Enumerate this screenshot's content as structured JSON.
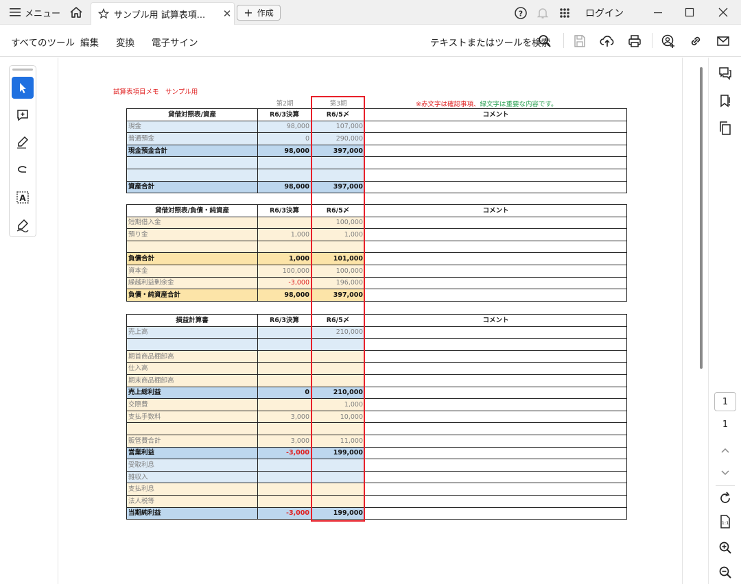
{
  "titlebar": {
    "menu_label": "メニュー",
    "tab_title": "サンプル用  試算表項...",
    "create_label": "作成",
    "login_label": "ログイン"
  },
  "toolbar": {
    "all_tools": "すべてのツール",
    "edit": "編集",
    "convert": "変換",
    "esign": "電子サイン",
    "search_text": "テキストまたはツールを検索"
  },
  "page_nav": {
    "current": "1",
    "total": "1"
  },
  "sheet": {
    "title": "試算表項目メモ　サンプル用",
    "period2": "第2期",
    "period3": "第3期",
    "note_red1": "※赤文字は確認事項、",
    "note_green": "緑文字は重要な内容です。",
    "tables": [
      {
        "headers": [
          "貸借対照表/資産",
          "R6/3決算",
          "R6/5〆",
          "コメント"
        ],
        "rows": [
          {
            "style": "blue",
            "label": "現金",
            "v1": "98,000",
            "v2": "107,000"
          },
          {
            "style": "blue",
            "label": "普通預金",
            "v1": "0",
            "v2": "290,000"
          },
          {
            "style": "bluebold",
            "label": "現金預金合計",
            "v1": "98,000",
            "v2": "397,000"
          },
          {
            "style": "blue",
            "label": "",
            "v1": "",
            "v2": ""
          },
          {
            "style": "blue",
            "label": "",
            "v1": "",
            "v2": ""
          },
          {
            "style": "bluebold",
            "label": "資産合計",
            "v1": "98,000",
            "v2": "397,000"
          }
        ]
      },
      {
        "headers": [
          "貸借対照表/負債・純資産",
          "R6/3決算",
          "R6/5〆",
          "コメント"
        ],
        "rows": [
          {
            "style": "tan",
            "label": "短期借入金",
            "v1": "",
            "v2": "100,000"
          },
          {
            "style": "tan",
            "label": "預り金",
            "v1": "1,000",
            "v2": "1,000"
          },
          {
            "style": "tan",
            "label": "",
            "v1": "",
            "v2": ""
          },
          {
            "style": "tanbold",
            "label": "負債合計",
            "v1": "1,000",
            "v2": "101,000"
          },
          {
            "style": "tan",
            "label": "資本金",
            "v1": "100,000",
            "v2": "100,000"
          },
          {
            "style": "tan",
            "label": "繰越利益剰余金",
            "v1": "-3,000",
            "v2": "196,000",
            "neg1": true
          },
          {
            "style": "tanbold",
            "label": "負債・純資産合計",
            "v1": "98,000",
            "v2": "397,000"
          }
        ]
      },
      {
        "headers": [
          "損益計算書",
          "R6/3決算",
          "R6/5〆",
          "コメント"
        ],
        "rows": [
          {
            "style": "blue",
            "label": "売上高",
            "v1": "",
            "v2": "210,000"
          },
          {
            "style": "blue",
            "label": "",
            "v1": "",
            "v2": ""
          },
          {
            "style": "tan",
            "label": "期首商品棚卸高",
            "v1": "",
            "v2": ""
          },
          {
            "style": "tan",
            "label": "仕入高",
            "v1": "",
            "v2": ""
          },
          {
            "style": "tan",
            "label": "期末商品棚卸高",
            "v1": "",
            "v2": ""
          },
          {
            "style": "bluebold",
            "label": "売上総利益",
            "v1": "0",
            "v2": "210,000"
          },
          {
            "style": "tan",
            "label": "交際費",
            "v1": "",
            "v2": "1,000"
          },
          {
            "style": "tan",
            "label": "支払手数料",
            "v1": "3,000",
            "v2": "10,000"
          },
          {
            "style": "tan",
            "label": "",
            "v1": "",
            "v2": ""
          },
          {
            "style": "tan",
            "label": "販管費合計",
            "v1": "3,000",
            "v2": "11,000"
          },
          {
            "style": "bluebold",
            "label": "営業利益",
            "v1": "-3,000",
            "v2": "199,000",
            "neg1": true
          },
          {
            "style": "blue",
            "label": "受取利息",
            "v1": "",
            "v2": ""
          },
          {
            "style": "blue",
            "label": "雑収入",
            "v1": "",
            "v2": ""
          },
          {
            "style": "tan",
            "label": "支払利息",
            "v1": "",
            "v2": ""
          },
          {
            "style": "tan",
            "label": "法人税等",
            "v1": "",
            "v2": ""
          },
          {
            "style": "bluebold",
            "label": "当期純利益",
            "v1": "-3,000",
            "v2": "199,000",
            "neg1": true
          }
        ]
      }
    ]
  }
}
